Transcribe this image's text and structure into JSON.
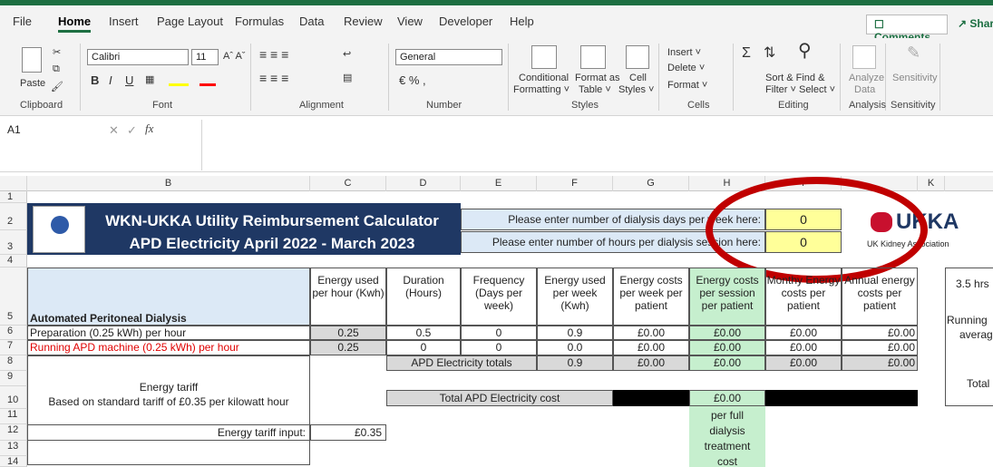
{
  "ribbon": {
    "menu": [
      "File",
      "Home",
      "Insert",
      "Page Layout",
      "Formulas",
      "Data",
      "Review",
      "View",
      "Developer",
      "Help"
    ],
    "comments": "Comments",
    "share": "Share",
    "paste": "Paste",
    "font_name": "Calibri",
    "font_size": "11",
    "number_format": "General",
    "conditional": "Conditional",
    "formatting": "Formatting ˅",
    "format_as": "Format as",
    "table": "Table ˅",
    "cell": "Cell",
    "styles_btn": "Styles ˅",
    "insert": "Insert ˅",
    "delete": "Delete ˅",
    "format": "Format ˅",
    "sort": "Sort & Find &",
    "filter_select": "Filter ˅ Select ˅",
    "analyze": "Analyze",
    "data": "Data",
    "sensitivity": "Sensitivity",
    "groups": [
      "Clipboard",
      "Font",
      "Alignment",
      "Number",
      "Styles",
      "Cells",
      "Editing",
      "Analysis",
      "Sensitivity"
    ]
  },
  "formula": {
    "cell_ref": "A1",
    "fx": "fx"
  },
  "columns": [
    "B",
    "C",
    "D",
    "E",
    "F",
    "G",
    "H",
    "I",
    "K"
  ],
  "rows": [
    "1",
    "2",
    "3",
    "4",
    "5",
    "6",
    "7",
    "8",
    "9",
    "10",
    "11",
    "12",
    "13",
    "14"
  ],
  "sheet": {
    "title1": "WKN-UKKA Utility Reimbursement Calculator",
    "title2": "APD Electricity   April 2022 - March 2023",
    "prompt_days": "Please enter number of dialysis days per week here:",
    "prompt_hours": "Please enter number of hours per dialysis session here:",
    "days_value": "0",
    "hours_value": "0",
    "logo_text": "UKKA",
    "logo_sub": "UK Kidney Association",
    "section": "Automated Peritoneal Dialysis",
    "headers": [
      "Energy used per hour (Kwh)",
      "Duration (Hours)",
      "Frequency (Days per week)",
      "Energy used per week (Kwh)",
      "Energy costs per week per patient",
      "Energy costs per session per patient",
      "Monthy Energy costs per patient",
      "Annual energy costs per patient"
    ],
    "row6": {
      "label": "Preparation  (0.25 kWh) per hour",
      "values": [
        "0.25",
        "0.5",
        "0",
        "0.9",
        "£0.00",
        "£0.00",
        "£0.00",
        "£0.00"
      ]
    },
    "row7": {
      "label": "Running APD machine (0.25 kWh) per hour",
      "values": [
        "0.25",
        "0",
        "0",
        "0.0",
        "£0.00",
        "£0.00",
        "£0.00",
        "£0.00"
      ]
    },
    "row8": {
      "label": "APD Electricity totals",
      "values": [
        "0.9",
        "£0.00",
        "£0.00",
        "£0.00",
        "£0.00"
      ]
    },
    "tariff_title": "Energy tariff",
    "tariff_note": "Based on standard tariff of £0.35 per kilowatt hour",
    "total_label": "Total APD Electricity cost",
    "total_value": "£0.00",
    "per_full": "per full dialysis treatment cost",
    "tariff_input_label": "Energy tariff input:",
    "tariff_input_value": "£0.35",
    "side_note1": "3.5 hrs",
    "side_note2": "Running",
    "side_note3": "averag",
    "side_note4": "Total"
  }
}
